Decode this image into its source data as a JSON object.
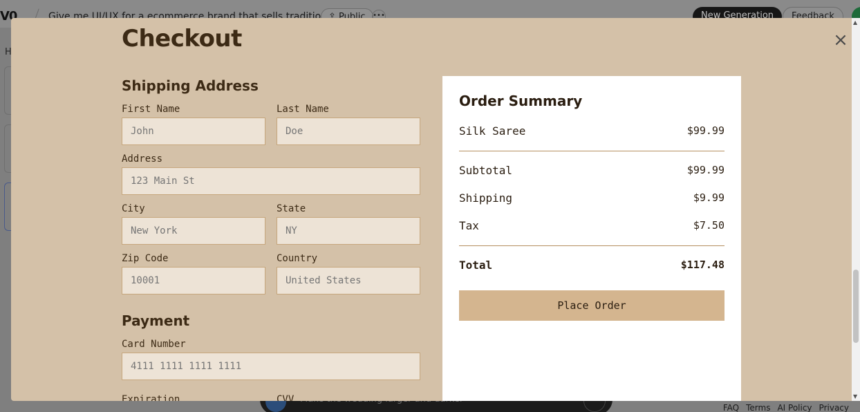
{
  "background_app": {
    "logo": "V0",
    "chat_title": "Give me UI/UX for a ecommerce brand that sells traditio...",
    "public_label": "Public",
    "more_label": "•••",
    "new_generation_label": "New Generation",
    "feedback_label": "Feedback",
    "sidebar_letter": "H",
    "chat_placeholder": "Make the wedding larger and darker",
    "footer_links": [
      "FAQ",
      "Terms",
      "AI Policy",
      "Privacy"
    ]
  },
  "modal": {
    "title": "Checkout",
    "close_label": "×",
    "shipping": {
      "heading": "Shipping Address",
      "first_name": {
        "label": "First Name",
        "placeholder": "John"
      },
      "last_name": {
        "label": "Last Name",
        "placeholder": "Doe"
      },
      "address": {
        "label": "Address",
        "placeholder": "123 Main St"
      },
      "city": {
        "label": "City",
        "placeholder": "New York"
      },
      "state": {
        "label": "State",
        "placeholder": "NY"
      },
      "zip": {
        "label": "Zip Code",
        "placeholder": "10001"
      },
      "country": {
        "label": "Country",
        "placeholder": "United States"
      }
    },
    "payment": {
      "heading": "Payment",
      "card_number": {
        "label": "Card Number",
        "placeholder": "4111 1111 1111 1111"
      },
      "expiration": {
        "label": "Expiration"
      },
      "cvv": {
        "label": "CVV"
      }
    },
    "summary": {
      "heading": "Order Summary",
      "items": [
        {
          "name": "Silk Saree",
          "price": "$99.99"
        }
      ],
      "subtotal_label": "Subtotal",
      "subtotal": "$99.99",
      "shipping_label": "Shipping",
      "shipping": "$9.99",
      "tax_label": "Tax",
      "tax": "$7.50",
      "total_label": "Total",
      "total": "$117.48",
      "place_order_label": "Place Order"
    }
  },
  "colors": {
    "modal_bg": "#d4c1a8",
    "input_bg": "#ede3d6",
    "input_border": "#c6a67c",
    "text_dark": "#3c2a15",
    "button_bg": "#d4b58f"
  }
}
